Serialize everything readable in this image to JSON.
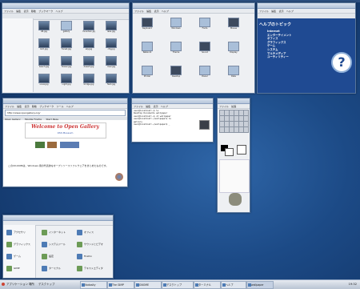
{
  "colors": {
    "desktop": "#1c4a86",
    "help_header": "#1f4a92",
    "gallery_title": "#cc3333",
    "taskbar": "#c4cedc"
  },
  "file_manager": {
    "menus": [
      "ファイル",
      "編集",
      "表示",
      "移動",
      "ブックマーク",
      "ヘルプ"
    ],
    "items": [
      {
        "label": "08.jpg",
        "icon": "image"
      },
      {
        "label": "gallery",
        "icon": "folder"
      },
      {
        "label": "mountain.jpg",
        "icon": "image"
      },
      {
        "label": "lake.jpg",
        "icon": "image"
      },
      {
        "label": "bird.jpg",
        "icon": "image"
      },
      {
        "label": "forest.jpg",
        "icon": "image"
      },
      {
        "label": "sky.jpg",
        "icon": "image"
      },
      {
        "label": "city.jpg",
        "icon": "image"
      },
      {
        "label": "beach.jpg",
        "icon": "image"
      },
      {
        "label": "flower.jpg",
        "icon": "image"
      },
      {
        "label": "desert.jpg",
        "icon": "image"
      },
      {
        "label": "river.jpg",
        "icon": "image"
      },
      {
        "label": "snow.jpg",
        "icon": "image"
      },
      {
        "label": "night.jpg",
        "icon": "image"
      },
      {
        "label": "bridge.jpg",
        "icon": "image"
      },
      {
        "label": "field.jpg",
        "icon": "image"
      }
    ]
  },
  "control_center": {
    "menus": [
      "ファイル",
      "編集",
      "表示",
      "ヘルプ"
    ],
    "items": [
      {
        "label": "Keyboard",
        "icon": "gear"
      },
      {
        "label": "Windows",
        "icon": "windows"
      },
      {
        "label": "Fonts",
        "icon": "fonts"
      },
      {
        "label": "Mouse",
        "icon": "mouse"
      },
      {
        "label": "Network",
        "icon": "network"
      },
      {
        "label": "Theme",
        "icon": "theme"
      },
      {
        "label": "Sound",
        "icon": "sound"
      },
      {
        "label": "Display",
        "icon": "display"
      },
      {
        "label": "Printer",
        "icon": "printer"
      },
      {
        "label": "Desktop",
        "icon": "desktop"
      },
      {
        "label": "Power",
        "icon": "power"
      },
      {
        "label": "Date",
        "icon": "clock"
      }
    ]
  },
  "help_browser": {
    "menus": [
      "ファイル",
      "編集",
      "表示",
      "ヘルプ"
    ],
    "heading": "ヘルプのトピック",
    "topics": [
      "Internet",
      "エンターテイメント",
      "オフィス",
      "グラフィックス",
      "ゲーム",
      "システム",
      "マルチメディア",
      "ユーティリティー"
    ]
  },
  "web_browser": {
    "menus": [
      "ファイル",
      "編集",
      "表示",
      "移動",
      "ブックマーク",
      "ツール",
      "ヘルプ"
    ],
    "url": "http://www.opengallery.org/",
    "tabs": [
      "Open Gallery",
      "Mozilla Firefox",
      "Start Page"
    ],
    "banner_title": "Welcome to Open Gallery",
    "banner_sub": "OSS Museum",
    "body_text": "このCD-ROMは、Windows 用の代表的なオープンソースソフトウェアをまとめたものです。"
  },
  "terminal": {
    "menus": [
      "ファイル",
      "編集",
      "表示",
      "ヘルプ"
    ],
    "lines": [
      "user@localhost:~$ ls",
      "Desktop  Documents  wallpaper",
      "user@localhost:~$ cd wallpaper",
      "user@localhost:~/wallpaper$ ls",
      "gallery",
      "user@localhost:~/wallpaper$ _"
    ]
  },
  "gimp": {
    "title": "The GIMP",
    "menus": [
      "ファイル",
      "拡張"
    ]
  },
  "app_menu": {
    "items": [
      {
        "label": "アクセサリ",
        "icon": "tools"
      },
      {
        "label": "インターネット",
        "icon": "globe"
      },
      {
        "label": "オフィス",
        "icon": "office"
      },
      {
        "label": "グラフィックス",
        "icon": "paint"
      },
      {
        "label": "システムツール",
        "icon": "terminal"
      },
      {
        "label": "サウンドとビデオ",
        "icon": "sound"
      },
      {
        "label": "ゲーム",
        "icon": "game"
      },
      {
        "label": "設定",
        "icon": "gear"
      },
      {
        "label": "Firefox",
        "icon": "firefox"
      },
      {
        "label": "GIMP",
        "icon": "paint"
      },
      {
        "label": "ターミナル",
        "icon": "terminal"
      },
      {
        "label": "テキストエディタ",
        "icon": "office"
      }
    ]
  },
  "taskbar": {
    "app_menu": "アプリケーション",
    "places": "場所",
    "desktop": "デスクトップ",
    "tasks": [
      "Vadosity",
      "The GIMP",
      "GNOME",
      "デスクトップ",
      "ターミナル",
      "ヘルプ",
      "wallpaper"
    ],
    "clock": "19:32"
  }
}
